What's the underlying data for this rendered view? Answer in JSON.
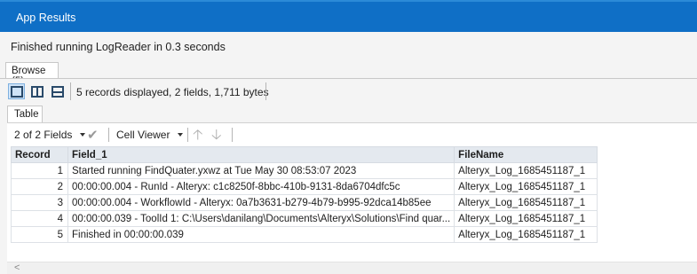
{
  "window": {
    "title": "App Results"
  },
  "status": {
    "message": "Finished running LogReader in 0.3 seconds"
  },
  "tabs": {
    "browse_label": "Browse (5)",
    "table_label": "Table"
  },
  "toolbar": {
    "records_info": "5 records displayed, 2 fields, 1,711 bytes"
  },
  "toolbar2": {
    "fields_selector": "2 of 2 Fields",
    "cell_viewer": "Cell Viewer"
  },
  "grid": {
    "headers": [
      "Record",
      "Field_1",
      "FileName"
    ],
    "rows": [
      {
        "record": "1",
        "field_1": "Started running FindQuater.yxwz at Tue May 30 08:53:07 2023",
        "filename": "Alteryx_Log_1685451187_1"
      },
      {
        "record": "2",
        "field_1": "00:00:00.004 - RunId - Alteryx: c1c8250f-8bbc-410b-9131-8da6704dfc5c",
        "filename": "Alteryx_Log_1685451187_1"
      },
      {
        "record": "3",
        "field_1": "00:00:00.004 - WorkflowId - Alteryx: 0a7b3631-b279-4b79-b995-92dca14b85ee",
        "filename": "Alteryx_Log_1685451187_1"
      },
      {
        "record": "4",
        "field_1": "00:00:00.039 - ToolId 1: C:\\Users\\danilang\\Documents\\Alteryx\\Solutions\\Find quar...",
        "filename": "Alteryx_Log_1685451187_1"
      },
      {
        "record": "5",
        "field_1": "Finished in 00:00:00.039",
        "filename": "Alteryx_Log_1685451187_1"
      }
    ]
  },
  "colors": {
    "titlebar": "#0f6fc6",
    "header_bg": "#e4e9ef"
  }
}
